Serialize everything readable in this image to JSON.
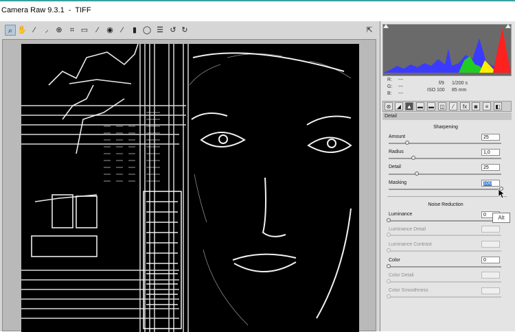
{
  "window": {
    "title": "Camera Raw 9.3.1  -  TIFF"
  },
  "toolbar": {
    "tools": [
      {
        "name": "zoom-tool",
        "glyph": "⌕"
      },
      {
        "name": "hand-tool",
        "glyph": "✋"
      },
      {
        "name": "white-balance-tool",
        "glyph": "⁄"
      },
      {
        "name": "color-sampler-tool",
        "glyph": "⸝"
      },
      {
        "name": "targeted-adjustment-tool",
        "glyph": "⊕"
      },
      {
        "name": "crop-tool",
        "glyph": "⌗"
      },
      {
        "name": "straighten-tool",
        "glyph": "▭"
      },
      {
        "name": "spot-removal-tool",
        "glyph": "⁄"
      },
      {
        "name": "red-eye-tool",
        "glyph": "◉"
      },
      {
        "name": "adjustment-brush-tool",
        "glyph": "⁄"
      },
      {
        "name": "graduated-filter-tool",
        "glyph": "▮"
      },
      {
        "name": "radial-filter-tool",
        "glyph": "◯"
      },
      {
        "name": "preferences-tool",
        "glyph": "☰"
      },
      {
        "name": "rotate-left-tool",
        "glyph": "↺"
      },
      {
        "name": "rotate-right-tool",
        "glyph": "↻"
      }
    ],
    "fullscreen_glyph": "⇱"
  },
  "info": {
    "r_label": "R:",
    "r_value": "---",
    "g_label": "G:",
    "g_value": "---",
    "b_label": "B:",
    "b_value": "---",
    "aperture": "f/9",
    "shutter": "1/200 s",
    "iso": "ISO 100",
    "focal": "85 mm"
  },
  "panel": {
    "title": "Detail",
    "tab_icons": [
      "⊛",
      "◢",
      "▲",
      "▬",
      "▬",
      "◫",
      "⁄",
      "fx",
      "◙",
      "≡",
      "◧"
    ],
    "sharpening": {
      "title": "Sharpening",
      "params": [
        {
          "label": "Amount",
          "value": "25",
          "pos": 0.167
        },
        {
          "label": "Radius",
          "value": "1,0",
          "pos": 0.222
        },
        {
          "label": "Detail",
          "value": "25",
          "pos": 0.25
        },
        {
          "label": "Masking",
          "value": "100",
          "pos": 1.0
        }
      ]
    },
    "noise": {
      "title": "Noise Reduction",
      "params": [
        {
          "label": "Luminance",
          "value": "0",
          "pos": 0.0,
          "enabled": true
        },
        {
          "label": "Luminance Detail",
          "value": "",
          "pos": 0.0,
          "enabled": false
        },
        {
          "label": "Luminance Contrast",
          "value": "",
          "pos": 0.0,
          "enabled": false
        },
        {
          "label": "Color",
          "value": "0",
          "pos": 0.0,
          "enabled": true
        },
        {
          "label": "Color Detail",
          "value": "",
          "pos": 0.0,
          "enabled": false
        },
        {
          "label": "Color Smoothness",
          "value": "",
          "pos": 0.0,
          "enabled": false
        }
      ]
    }
  },
  "tooltip": {
    "text": "Alt"
  },
  "colors": {
    "histogram_bg": "#6a6a6a",
    "selection": "#3b7fd4"
  }
}
